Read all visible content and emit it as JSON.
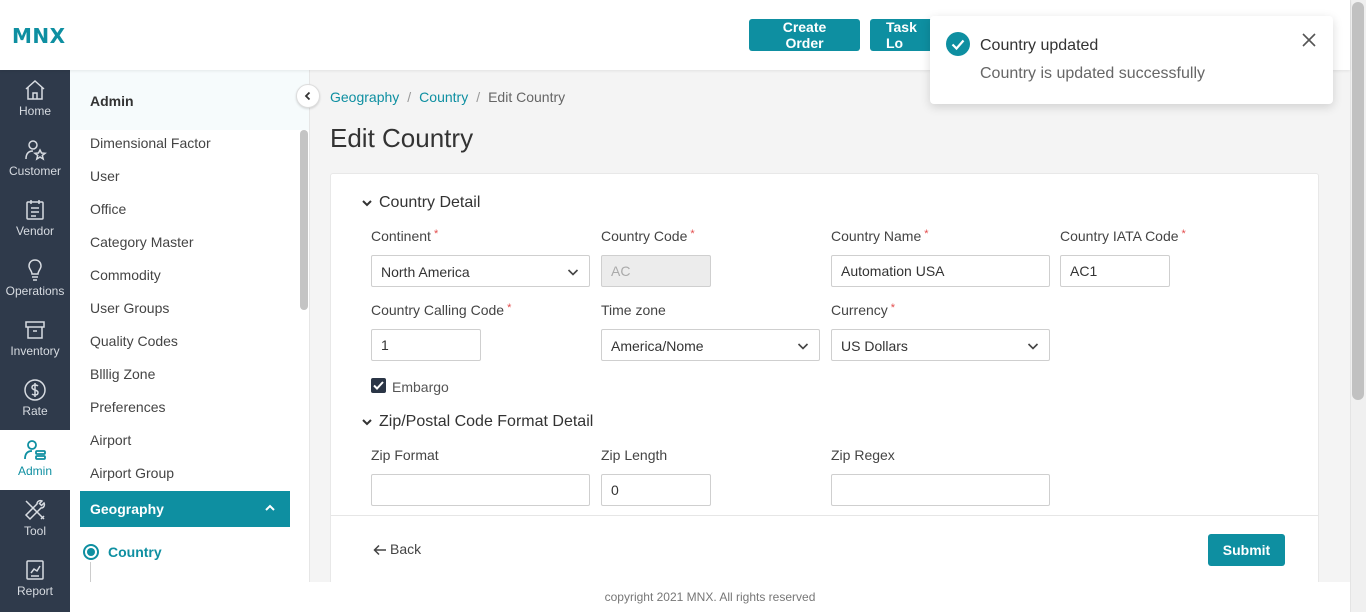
{
  "app": {
    "logo": "MNX"
  },
  "header": {
    "create_order": "Create Order",
    "task_log": "Task Lo"
  },
  "rail": [
    {
      "label": "Home",
      "icon": "home-icon"
    },
    {
      "label": "Customer",
      "icon": "customer-icon"
    },
    {
      "label": "Vendor",
      "icon": "vendor-icon"
    },
    {
      "label": "Operations",
      "icon": "bulb-icon"
    },
    {
      "label": "Inventory",
      "icon": "box-icon"
    },
    {
      "label": "Rate",
      "icon": "dollar-icon"
    },
    {
      "label": "Admin",
      "icon": "admin-icon",
      "active": true
    },
    {
      "label": "Tool",
      "icon": "tools-icon"
    },
    {
      "label": "Report",
      "icon": "report-icon"
    }
  ],
  "sidebar": {
    "title": "Admin",
    "items": [
      "Dimensional Factor",
      "User",
      "Office",
      "Category Master",
      "Commodity",
      "User Groups",
      "Quality Codes",
      "Blllig Zone",
      "Preferences",
      "Airport",
      "Airport Group"
    ],
    "group": "Geography",
    "sub_active": "Country"
  },
  "breadcrumb": {
    "c1": "Geography",
    "c2": "Country",
    "c3": "Edit Country",
    "sep": "/"
  },
  "page_title": "Edit Country",
  "form": {
    "section1": "Country Detail",
    "continent_label": "Continent",
    "continent_value": "North America",
    "country_code_label": "Country Code",
    "country_code_value": "AC",
    "country_name_label": "Country Name",
    "country_name_value": "Automation USA",
    "iata_label": "Country IATA Code",
    "iata_value": "AC1",
    "calling_label": "Country Calling Code",
    "calling_value": "1",
    "timezone_label": "Time zone",
    "timezone_value": "America/Nome",
    "currency_label": "Currency",
    "currency_value": "US Dollars",
    "embargo_label": "Embargo",
    "embargo_checked": true,
    "required_mark": "*",
    "section2": "Zip/Postal Code Format Detail",
    "zip_format_label": "Zip Format",
    "zip_format_value": "",
    "zip_length_label": "Zip Length",
    "zip_length_value": "0",
    "zip_regex_label": "Zip Regex",
    "zip_regex_value": "",
    "back": "Back",
    "submit": "Submit"
  },
  "footer": "copyright 2021 MNX. All rights reserved",
  "toast": {
    "title": "Country updated",
    "message": "Country is updated successfully"
  },
  "colors": {
    "accent": "#0e8fa1",
    "rail": "#2f3a4b"
  }
}
